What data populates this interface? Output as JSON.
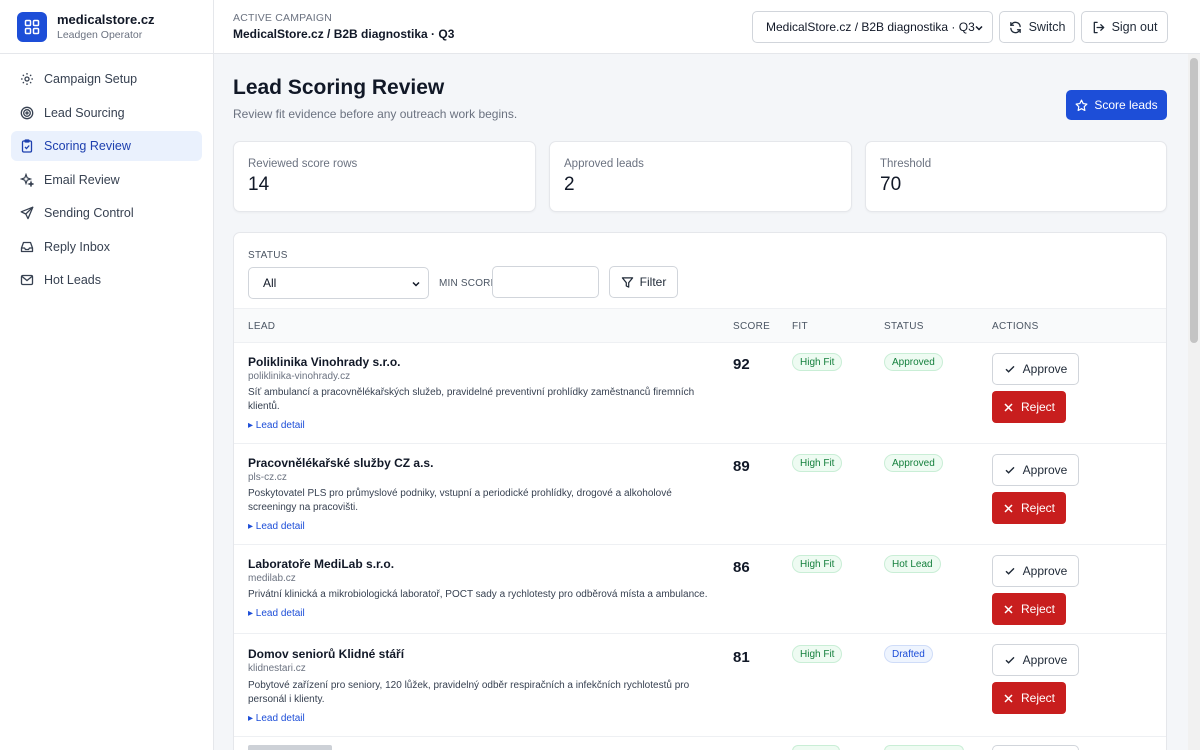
{
  "brand": {
    "name": "medicalstore.cz",
    "role": "Leadgen Operator"
  },
  "sidebar": {
    "items": [
      {
        "label": "Campaign Setup",
        "icon": "gear-icon"
      },
      {
        "label": "Lead Sourcing",
        "icon": "target-icon"
      },
      {
        "label": "Scoring Review",
        "icon": "clipboard-check-icon",
        "active": true
      },
      {
        "label": "Email Review",
        "icon": "sparkles-icon"
      },
      {
        "label": "Sending Control",
        "icon": "send-icon"
      },
      {
        "label": "Reply Inbox",
        "icon": "inbox-icon"
      },
      {
        "label": "Hot Leads",
        "icon": "mail-icon"
      }
    ]
  },
  "topbar": {
    "campaign_label": "ACTIVE CAMPAIGN",
    "campaign_name": "MedicalStore.cz / B2B diagnostika · Q3",
    "campaign_select": "MedicalStore.cz / B2B diagnostika · Q3",
    "switch_label": "Switch",
    "signout_label": "Sign out"
  },
  "page": {
    "title": "Lead Scoring Review",
    "subtitle": "Review fit evidence before any outreach work begins.",
    "score_button": "Score leads"
  },
  "stats": [
    {
      "label": "Reviewed score rows",
      "value": "14"
    },
    {
      "label": "Approved leads",
      "value": "2"
    },
    {
      "label": "Threshold",
      "value": "70"
    }
  ],
  "filters": {
    "status_label": "STATUS",
    "status_value": "All",
    "min_score_label": "MIN SCORE",
    "min_score_value": "",
    "filter_button": "Filter"
  },
  "table": {
    "columns": {
      "lead": "LEAD",
      "score": "SCORE",
      "fit": "FIT",
      "status": "STATUS",
      "actions": "ACTIONS"
    },
    "approve_label": "Approve",
    "reject_label": "Reject",
    "detail_label": "▸ Lead detail",
    "rows": [
      {
        "name": "Poliklinika Vinohrady s.r.o.",
        "domain": "poliklinika-vinohrady.cz",
        "description": "Síť ambulancí a pracovnělékařských služeb, pravidelné preventivní prohlídky zaměstnanců firemních klientů.",
        "score": "92",
        "fit": "High Fit",
        "status": "Approved",
        "status_kind": "approved"
      },
      {
        "name": "Pracovnělékařské služby CZ a.s.",
        "domain": "pls-cz.cz",
        "description": "Poskytovatel PLS pro průmyslové podniky, vstupní a periodické prohlídky, drogové a alkoholové screeningy na pracovišti.",
        "score": "89",
        "fit": "High Fit",
        "status": "Approved",
        "status_kind": "approved"
      },
      {
        "name": "Laboratoře MediLab s.r.o.",
        "domain": "medilab.cz",
        "description": "Privátní klinická a mikrobiologická laboratoř, POCT sady a rychlotesty pro odběrová místa a ambulance.",
        "score": "86",
        "fit": "High Fit",
        "status": "Hot Lead",
        "status_kind": "hot"
      },
      {
        "name": "Domov seniorů Klidné stáří",
        "domain": "klidnestari.cz",
        "description": "Pobytové zařízení pro seniory, 120 lůžek, pravidelný odběr respiračních a infekčních rychlotestů pro personál i klienty.",
        "score": "81",
        "fit": "High Fit",
        "status": "Drafted",
        "status_kind": "drafted"
      }
    ]
  },
  "colors": {
    "accent": "#1d4ed8",
    "danger": "#c81e1e",
    "success": "#15803d",
    "active_nav_bg": "#eaf1fd"
  }
}
